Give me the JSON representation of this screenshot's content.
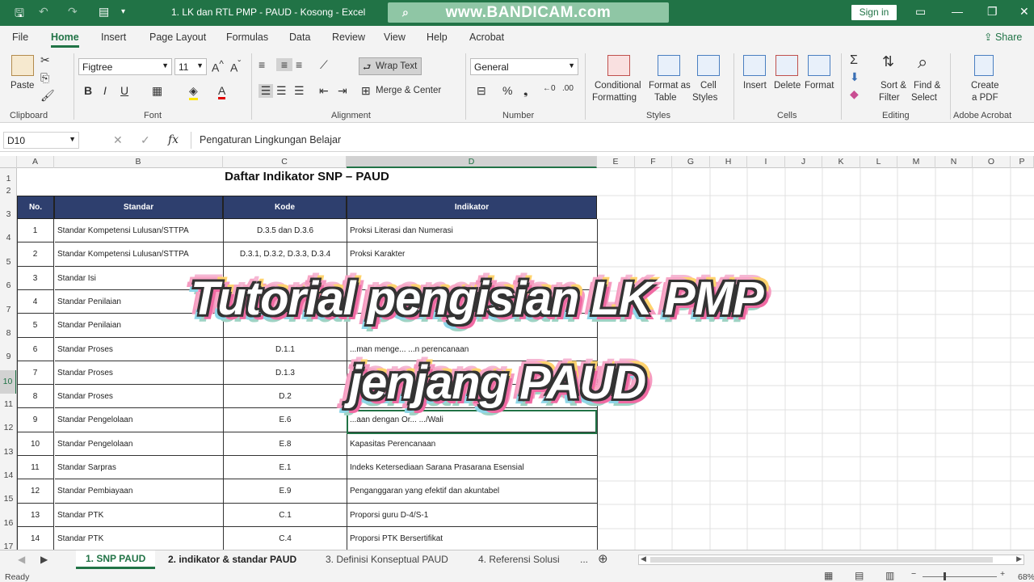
{
  "titlebar": {
    "doc_title": "1. LK dan RTL PMP - PAUD - Kosong  -  Excel",
    "watermark": "www.BANDICAM.com",
    "signin": "Sign in"
  },
  "menu": {
    "items": [
      "File",
      "Home",
      "Insert",
      "Page Layout",
      "Formulas",
      "Data",
      "Review",
      "View",
      "Help",
      "Acrobat"
    ],
    "share": "Share"
  },
  "ribbon": {
    "clipboard": {
      "paste": "Paste",
      "group": "Clipboard"
    },
    "font": {
      "name": "Figtree",
      "size": "11",
      "group": "Font",
      "bold": "B",
      "italic": "I",
      "underline": "U"
    },
    "alignment": {
      "wrap": "Wrap Text",
      "merge": "Merge & Center",
      "group": "Alignment"
    },
    "number": {
      "format": "General",
      "group": "Number"
    },
    "styles": {
      "conditional": "Conditional",
      "conditional2": "Formatting",
      "format_as": "Format as",
      "format_as2": "Table",
      "cell": "Cell",
      "cell2": "Styles",
      "group": "Styles"
    },
    "cells": {
      "insert": "Insert",
      "delete": "Delete",
      "format": "Format",
      "group": "Cells"
    },
    "editing": {
      "sort": "Sort &",
      "sort2": "Filter",
      "find": "Find &",
      "find2": "Select",
      "group": "Editing"
    },
    "acrobat": {
      "create": "Create",
      "create2": "a PDF",
      "group": "Adobe Acrobat"
    }
  },
  "formula": {
    "namebox": "D10",
    "fx": "fx",
    "content": "Pengaturan Lingkungan Belajar"
  },
  "columns": [
    "A",
    "B",
    "C",
    "D",
    "E",
    "F",
    "G",
    "H",
    "I",
    "J",
    "K",
    "L",
    "M",
    "N",
    "O",
    "P"
  ],
  "rows": [
    "1",
    "2",
    "3",
    "4",
    "5",
    "6",
    "7",
    "8",
    "9",
    "10",
    "11",
    "12",
    "13",
    "14",
    "15",
    "16",
    "17"
  ],
  "sheet": {
    "title": "Daftar Indikator SNP – PAUD",
    "headers": [
      "No.",
      "Standar",
      "Kode",
      "Indikator"
    ],
    "data": [
      [
        "1",
        "Standar Kompetensi Lulusan/STTPA",
        "D.3.5 dan D.3.6",
        "Proksi Literasi dan Numerasi"
      ],
      [
        "2",
        "Standar Kompetensi Lulusan/STTPA",
        "D.3.1, D.3.2, D.3.3, D.3.4",
        "Proksi Karakter"
      ],
      [
        "3",
        "Standar Isi",
        "",
        ""
      ],
      [
        "4",
        "Standar Penilaian",
        "",
        ""
      ],
      [
        "5",
        "Standar Penilaian",
        "",
        ""
      ],
      [
        "6",
        "Standar Proses",
        "D.1.1",
        "...man menge... ...n perencanaan"
      ],
      [
        "7",
        "Standar Proses",
        "D.1.3",
        ""
      ],
      [
        "8",
        "Standar Proses",
        "D.2",
        ""
      ],
      [
        "9",
        "Standar Pengelolaan",
        "E.6",
        "...aan dengan Or... .../Wali"
      ],
      [
        "10",
        "Standar Pengelolaan",
        "E.8",
        "Kapasitas Perencanaan"
      ],
      [
        "11",
        "Standar Sarpras",
        "E.1",
        "Indeks Ketersediaan Sarana Prasarana Esensial"
      ],
      [
        "12",
        "Standar Pembiayaan",
        "E.9",
        "Penganggaran yang efektif dan akuntabel"
      ],
      [
        "13",
        "Standar PTK",
        "C.1",
        "Proporsi guru D-4/S-1"
      ],
      [
        "14",
        "Standar PTK",
        "C.4",
        "Proporsi PTK Bersertifikat"
      ]
    ]
  },
  "overlay": {
    "line1": "Tutorial pengisian LK PMP",
    "line2": "jenjang PAUD"
  },
  "tabs": [
    "1. SNP PAUD",
    "2. indikator & standar PAUD",
    "3. Definisi Konseptual PAUD",
    "4. Referensi Solusi",
    "..."
  ],
  "status": {
    "ready": "Ready",
    "zoom": "68%"
  }
}
